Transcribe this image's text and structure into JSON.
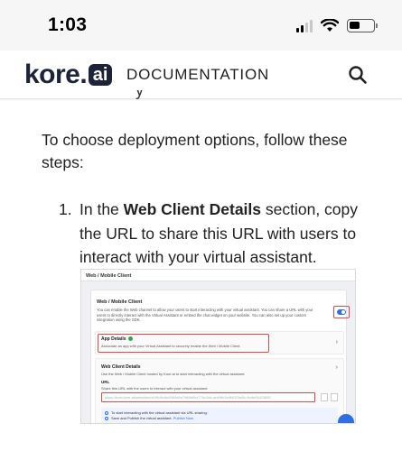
{
  "status_bar": {
    "time": "1:03"
  },
  "header": {
    "logo_text": "kore",
    "logo_badge": "ai",
    "nav_title": "DOCUMENTATION",
    "search_icon": "search-icon"
  },
  "content": {
    "clipped_text": "y",
    "intro": "To choose deployment options, follow these steps:",
    "step_number": "1.",
    "step_prefix": "In the ",
    "step_bold": "Web Client Details",
    "step_suffix": " section, copy the URL to share this URL with users to interact with your virtual assistant."
  },
  "screenshot": {
    "topbar_title": "Web / Mobile Client",
    "card_title": "Web / Mobile Client",
    "card_desc": "You can enable the Web channel to allow your users to start interacting with your virtual assistant. You can share a URL with your users to directly interact with the Virtual Assistant or embed the chat widget on your website. You can also set up your custom integration using the SDK.",
    "app_title": "App Details",
    "app_desc": "Associate an app with your Virtual Assistant to securely enable the Web / Mobile Client.",
    "wc_title": "Web Client Details",
    "wc_desc": "Use the Web / Mobile Client hosted by Kore.ai to start interacting with the virtual assistant.",
    "url_label": "URL",
    "url_desc": "Share this URL with the users to interact with your virtual assistant.",
    "url_value": "https://bots.kore.ai/webclient/e1f5d9c5e8984d6a7988bf5cf776c3db-ab89fb2e8f4023a5b-9ddb03d23850",
    "step_a": "To start interacting with the virtual assistant via URL sharing:",
    "step_b_prefix": "Save and Publish the virtual assistant.",
    "step_b_link": "Publish Now"
  },
  "colors": {
    "highlight": "#d44c4c",
    "accent": "#2f6fe4",
    "logo": "#1d2439"
  }
}
